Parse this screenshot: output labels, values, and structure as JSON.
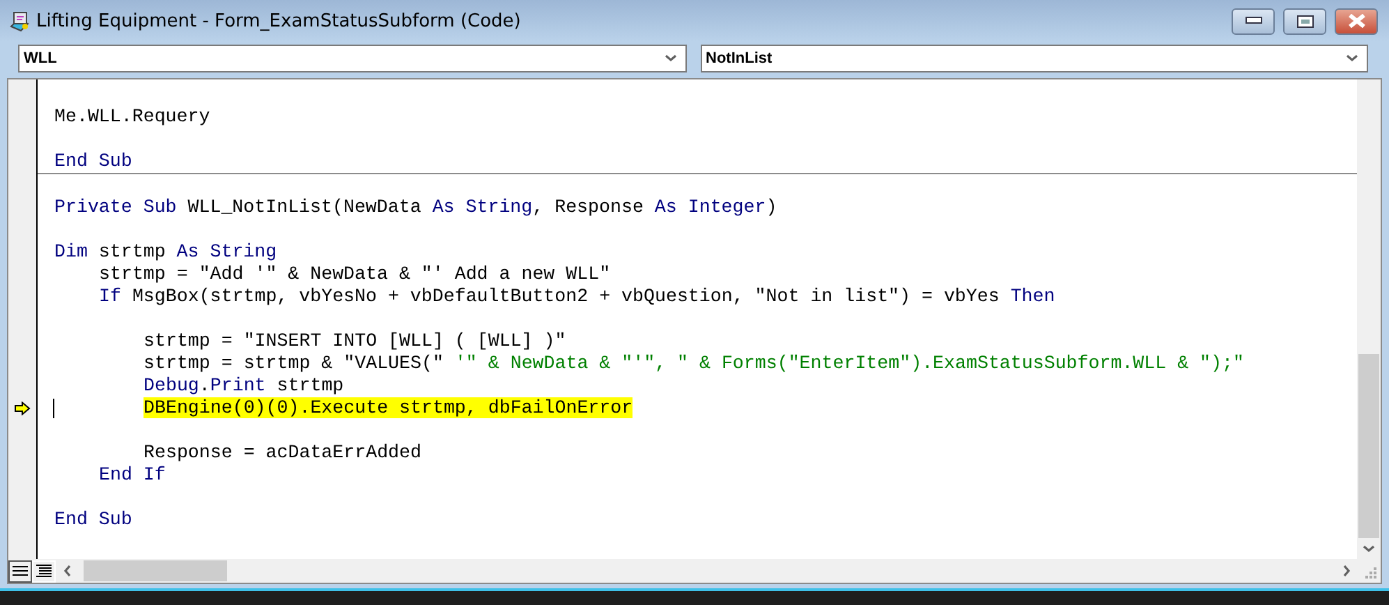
{
  "window": {
    "title": "Lifting Equipment - Form_ExamStatusSubform (Code)"
  },
  "object_combo": {
    "value": "WLL"
  },
  "procedure_combo": {
    "value": "NotInList"
  },
  "procedures": [
    {
      "lines": [
        {
          "kind": "blank"
        },
        {
          "kind": "code",
          "segments": [
            {
              "kind": "plain",
              "text": "Me.WLL.Requery"
            }
          ]
        },
        {
          "kind": "blank"
        },
        {
          "kind": "code",
          "segments": [
            {
              "kind": "keyword",
              "text": "End Sub"
            }
          ]
        }
      ]
    },
    {
      "lines": [
        {
          "kind": "blank"
        },
        {
          "kind": "code",
          "segments": [
            {
              "kind": "keyword",
              "text": "Private Sub"
            },
            {
              "kind": "plain",
              "text": " WLL_NotInList(NewData "
            },
            {
              "kind": "keyword",
              "text": "As String"
            },
            {
              "kind": "plain",
              "text": ", Response "
            },
            {
              "kind": "keyword",
              "text": "As Integer"
            },
            {
              "kind": "plain",
              "text": ")"
            }
          ]
        },
        {
          "kind": "blank"
        },
        {
          "kind": "code",
          "segments": [
            {
              "kind": "keyword",
              "text": "Dim"
            },
            {
              "kind": "plain",
              "text": " strtmp "
            },
            {
              "kind": "keyword",
              "text": "As String"
            }
          ],
          "children": [
            {
              "kind": "code",
              "segments": [
                {
                  "kind": "plain",
                  "text": "strtmp = \"Add '\" & NewData & \"' Add a new WLL\""
                }
              ]
            },
            {
              "kind": "code",
              "segments": [
                {
                  "kind": "keyword",
                  "text": "If"
                },
                {
                  "kind": "plain",
                  "text": " MsgBox(strtmp, vbYesNo + vbDefaultButton2 + vbQuestion, \"Not in list\") = vbYes "
                },
                {
                  "kind": "keyword",
                  "text": "Then"
                }
              ],
              "children": [
                {
                  "kind": "blank"
                },
                {
                  "kind": "code",
                  "segments": [
                    {
                      "kind": "plain",
                      "text": "strtmp = \"INSERT INTO [WLL] ( [WLL] )\""
                    }
                  ]
                },
                {
                  "kind": "code",
                  "segments": [
                    {
                      "kind": "plain",
                      "text": "strtmp = strtmp & \"VALUES(\" "
                    },
                    {
                      "kind": "comment",
                      "text": "'\" & NewData & \"'\", \" & Forms(\"EnterItem\").ExamStatusSubform.WLL & \");\""
                    }
                  ]
                },
                {
                  "kind": "code",
                  "segments": [
                    {
                      "kind": "keyword",
                      "text": "Debug"
                    },
                    {
                      "kind": "plain",
                      "text": "."
                    },
                    {
                      "kind": "keyword",
                      "text": "Print"
                    },
                    {
                      "kind": "plain",
                      "text": " strtmp"
                    }
                  ]
                },
                {
                  "kind": "code",
                  "current": true,
                  "caret": true,
                  "highlighted": true,
                  "segments": [
                    {
                      "kind": "plain",
                      "text": "DBEngine(0)(0).Execute strtmp, dbFailOnError"
                    }
                  ]
                },
                {
                  "kind": "blank"
                },
                {
                  "kind": "code",
                  "segments": [
                    {
                      "kind": "plain",
                      "text": "Response = acDataErrAdded"
                    }
                  ]
                }
              ]
            },
            {
              "kind": "code",
              "segments": [
                {
                  "kind": "keyword",
                  "text": "End If"
                }
              ]
            }
          ]
        },
        {
          "kind": "blank"
        },
        {
          "kind": "code",
          "segments": [
            {
              "kind": "keyword",
              "text": "End Sub"
            }
          ]
        }
      ]
    }
  ]
}
